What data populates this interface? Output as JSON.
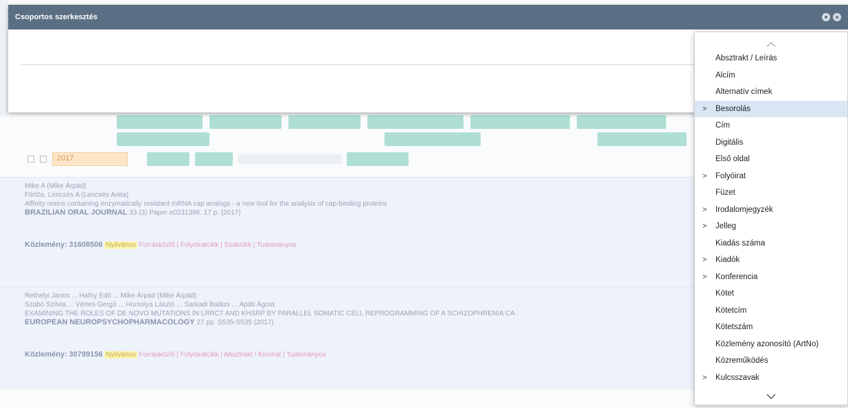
{
  "modal": {
    "title": "Csoportos szerkesztés"
  },
  "dropdown": {
    "items": [
      {
        "label": "Absztrakt / Leírás",
        "has_children": false,
        "active": false
      },
      {
        "label": "Alcím",
        "has_children": false,
        "active": false
      },
      {
        "label": "Alternatív címek",
        "has_children": false,
        "active": false
      },
      {
        "label": "Besorolás",
        "has_children": true,
        "active": true
      },
      {
        "label": "Cím",
        "has_children": false,
        "active": false
      },
      {
        "label": "Digitális",
        "has_children": false,
        "active": false
      },
      {
        "label": "Első oldal",
        "has_children": false,
        "active": false
      },
      {
        "label": "Folyóirat",
        "has_children": true,
        "active": false
      },
      {
        "label": "Füzet",
        "has_children": false,
        "active": false
      },
      {
        "label": "Irodalomjegyzék",
        "has_children": true,
        "active": false
      },
      {
        "label": "Jelleg",
        "has_children": true,
        "active": false
      },
      {
        "label": "Kiadás száma",
        "has_children": false,
        "active": false
      },
      {
        "label": "Kiadók",
        "has_children": true,
        "active": false
      },
      {
        "label": "Konferencia",
        "has_children": true,
        "active": false
      },
      {
        "label": "Kötet",
        "has_children": false,
        "active": false
      },
      {
        "label": "Kötetcím",
        "has_children": false,
        "active": false
      },
      {
        "label": "Kötetszám",
        "has_children": false,
        "active": false
      },
      {
        "label": "Közlemény azonosító (ArtNo)",
        "has_children": false,
        "active": false
      },
      {
        "label": "Közreműködés",
        "has_children": false,
        "active": false
      },
      {
        "label": "Kulcsszavak",
        "has_children": true,
        "active": false
      }
    ],
    "caret": ">"
  },
  "filter": {
    "year_value": "2017"
  },
  "publications": [
    {
      "type_label": "Közlemény:",
      "id": "31608506",
      "authors_line": "Mike A (Mike Árpád)",
      "author2_line": "Fürtös, Lencsés A (Lencsés Anita)",
      "title_line": "Affinity resins containing enzymatically resistant mRNA cap analogs - a new tool for the analysis of cap-binding proteins",
      "journal": "BRAZILIAN ORAL JOURNAL",
      "journal_details": "33 (3) Paper e0231396. 17 p. (2017)",
      "status": "Nyilvános",
      "extra": "Forrásközlő | Folyóiratcikk | Szakcikk | Tudományos"
    },
    {
      "type_label": "Közlemény:",
      "id": "30799156",
      "authors_line": "Rethelyi Janos ... Hathy Edit ... Mike Árpád (Mike Árpád)",
      "author2_line": "Szabó Szilvia ... Vértes Gergő ... Homolya László ... Sarkadi Balázs ... Apáti Ágota",
      "title_line": "EXAMINING THE ROLES OF DE NOVO MUTATIONS IN LRRC7 AND KHSRP BY PARALLEL SOMATIC CELL REPROGRAMMING OF A SCHIZOPHRENIA CA",
      "journal": "EUROPEAN NEUROPSYCHOPHARMACOLOGY",
      "journal_details": "27 pp. S535-S535 (2017)",
      "status": "Nyilvános",
      "extra": "Forrásközlő | Folyóiratcikk | Absztrakt / Kivonat | Tudományos"
    }
  ],
  "colors": {
    "header": "#5b6f84",
    "active_item": "#d9e7f5",
    "button": "#a6dccf"
  },
  "icons": [
    "settings-icon",
    "close-icon",
    "chevron-up-icon",
    "chevron-down-icon"
  ]
}
